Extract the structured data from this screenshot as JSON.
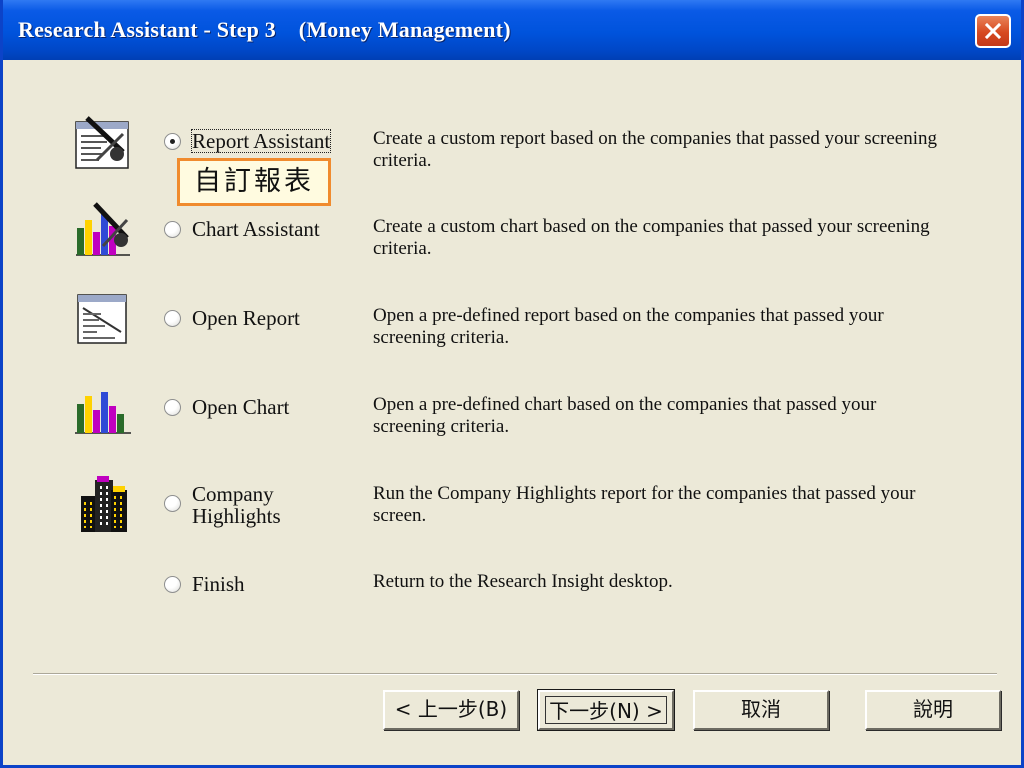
{
  "window": {
    "title": "Research Assistant - Step 3    (Money Management)",
    "close_icon": "close-icon"
  },
  "options": [
    {
      "id": "report-assistant",
      "label": "Report Assistant",
      "selected": true,
      "icon": "report-assistant-icon",
      "description": "Create a custom report based on the companies that passed your screening criteria."
    },
    {
      "id": "chart-assistant",
      "label": "Chart Assistant",
      "selected": false,
      "icon": "chart-assistant-icon",
      "description": "Create a custom chart based on the companies that passed your screening criteria."
    },
    {
      "id": "open-report",
      "label": "Open Report",
      "selected": false,
      "icon": "open-report-icon",
      "description": "Open a pre-defined report based on the companies that passed your screening criteria."
    },
    {
      "id": "open-chart",
      "label": "Open Chart",
      "selected": false,
      "icon": "open-chart-icon",
      "description": "Open a pre-defined chart based on the companies that passed your screening criteria."
    },
    {
      "id": "company-highlights",
      "label_line1": "Company",
      "label_line2": "Highlights",
      "selected": false,
      "icon": "company-buildings-icon",
      "description": "Run the Company Highlights report for the companies that passed your screen."
    },
    {
      "id": "finish",
      "label": "Finish",
      "selected": false,
      "description": "Return to the Research Insight desktop."
    }
  ],
  "annotation": {
    "text": "自訂報表",
    "border_color": "#f08b2e"
  },
  "buttons": {
    "back": "< 上一步(B)",
    "next": "下一步(N) >",
    "cancel": "取消",
    "help": "說明"
  },
  "colors": {
    "titlebar": "#0053dc",
    "dialog_bg": "#ece9d8",
    "close_button": "#d7491f",
    "annotation_border": "#f08b2e"
  }
}
